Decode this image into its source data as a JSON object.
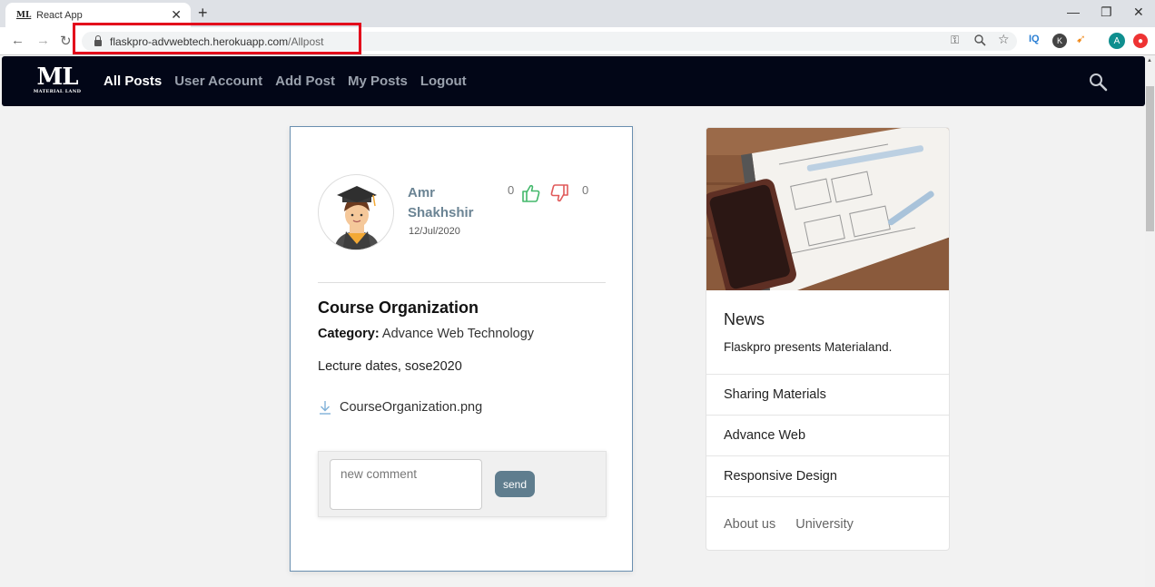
{
  "browser": {
    "tab_title": "React App",
    "tab_favicon_text": "ML",
    "url_domain": "flaskpro-advwebtech.herokuapp.com",
    "url_path": "/Allpost",
    "extension_a_label": "A",
    "extension_k_label": "K",
    "extension_iq_label": "IQ"
  },
  "navbar": {
    "logo_text": "ML",
    "logo_subtext": "MATERIAL LAND",
    "links": [
      "All Posts",
      "User Account",
      "Add Post",
      "My Posts",
      "Logout"
    ],
    "active_link": "All Posts"
  },
  "post": {
    "author": "Amr Shakhshir",
    "date": "12/Jul/2020",
    "likes": "0",
    "dislikes": "0",
    "title": "Course Organization",
    "category_label": "Category:",
    "category_value": " Advance Web Technology",
    "content": "Lecture dates, sose2020",
    "attachment": "CourseOrganization.png",
    "comment_placeholder": "new comment",
    "send_label": "send"
  },
  "sidebar": {
    "title": "News",
    "text": "Flaskpro presents Materialand.",
    "items": [
      "Sharing Materials",
      "Advance Web",
      "Responsive Design"
    ],
    "footer_links": [
      "About us",
      "University"
    ]
  },
  "colors": {
    "navbar_bg": "#020617",
    "accent": "#5f7d8e",
    "like": "#43b86b",
    "dislike": "#e05a5a",
    "highlight_box": "#e3001b"
  }
}
